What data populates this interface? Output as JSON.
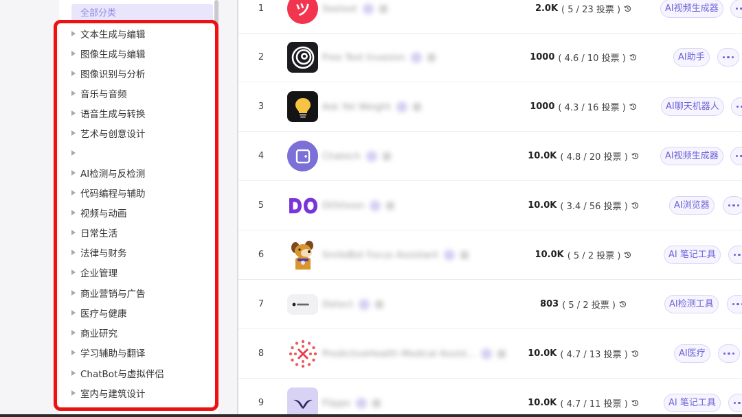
{
  "sidebar": {
    "all_label": "全部分类",
    "categories": [
      {
        "label": "文本生成与编辑"
      },
      {
        "label": "图像生成与编辑"
      },
      {
        "label": "图像识别与分析"
      },
      {
        "label": "音乐与音频"
      },
      {
        "label": "语音生成与转换"
      },
      {
        "label": "艺术与创意设计"
      },
      {
        "label": ""
      },
      {
        "label": "AI检测与反检测"
      },
      {
        "label": "代码编程与辅助"
      },
      {
        "label": "视频与动画"
      },
      {
        "label": "日常生活"
      },
      {
        "label": "法律与财务"
      },
      {
        "label": "企业管理"
      },
      {
        "label": "商业营销与广告"
      },
      {
        "label": "医疗与健康"
      },
      {
        "label": "商业研究"
      },
      {
        "label": "学习辅助与翻译"
      },
      {
        "label": "ChatBot与虚拟伴侣"
      },
      {
        "label": "室内与建筑设计"
      }
    ]
  },
  "table": {
    "rows": [
      {
        "rank": "1",
        "name": "Seeloot",
        "visits": "2.0K",
        "rating": "( 5 / 23 投票 )",
        "tag": "AI视频生成器",
        "logo": "tsu-icon"
      },
      {
        "rank": "2",
        "name": "Free Text Invasion",
        "visits": "1000",
        "rating": "( 4.6 / 10 投票 )",
        "tag": "AI助手",
        "logo": "spiral-eye-icon"
      },
      {
        "rank": "3",
        "name": "Ask Yet Weight",
        "visits": "1000",
        "rating": "( 4.3 / 16 投票 )",
        "tag": "AI聊天机器人",
        "logo": "lightbulb-icon"
      },
      {
        "rank": "4",
        "name": "Chatech",
        "visits": "10.0K",
        "rating": "( 4.8 / 20 投票 )",
        "tag": "AI视频生成器",
        "logo": "square-plus-icon"
      },
      {
        "rank": "5",
        "name": "DOVision",
        "visits": "10.0K",
        "rating": "( 3.4 / 56 投票 )",
        "tag": "AI浏览器",
        "logo": "do-icon"
      },
      {
        "rank": "6",
        "name": "SmileBot Focus Assistant",
        "visits": "10.0K",
        "rating": "( 5 / 2 投票 )",
        "tag": "AI 笔记工具",
        "logo": "dog-icon"
      },
      {
        "rank": "7",
        "name": "Detect",
        "visits": "803",
        "rating": "( 5 / 2 投票 )",
        "tag": "AI检测工具",
        "logo": "textlogo-icon"
      },
      {
        "rank": "8",
        "name": "PredictiveHealth Medical Assist...",
        "visits": "10.0K",
        "rating": "( 4.7 / 13 投票 )",
        "tag": "AI医疗",
        "logo": "dots-cross-icon"
      },
      {
        "rank": "9",
        "name": "Flippo",
        "visits": "10.0K",
        "rating": "( 4.7 / 11 投票 )",
        "tag": "AI 笔记工具",
        "logo": "wings-icon"
      }
    ]
  },
  "colors": {
    "accent": "#6c63d8",
    "highlight_box": "#ee1111"
  }
}
